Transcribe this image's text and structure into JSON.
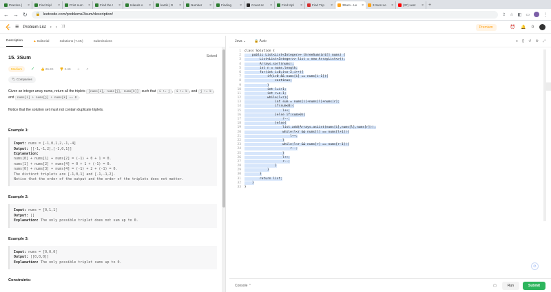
{
  "browser": {
    "tabs": [
      {
        "label": "Practice |",
        "color": "#2e7d32"
      },
      {
        "label": "Find tripl",
        "color": "#2e7d32"
      },
      {
        "label": "Print num",
        "color": "#2e7d32"
      },
      {
        "label": "Find the !",
        "color": "#2e7d32"
      },
      {
        "label": "Islands o",
        "color": "#2e7d32"
      },
      {
        "label": "kartik | G",
        "color": "#2e7d32"
      },
      {
        "label": "Number",
        "color": "#2e7d32"
      },
      {
        "label": "Finding",
        "color": "#2e7d32"
      },
      {
        "label": "Count sc",
        "color": "#222"
      },
      {
        "label": "Find tripl",
        "color": "#2e7d32"
      },
      {
        "label": "Find Trip",
        "color": "#d32f2f"
      },
      {
        "label": "3Sum - Le",
        "color": "#ffa116",
        "active": true
      },
      {
        "label": "3 Sum Le",
        "color": "#ffa116"
      },
      {
        "label": "(37) Leet",
        "color": "#ff0000"
      }
    ],
    "url": "leetcode.com/problems/3sum/description/"
  },
  "header": {
    "problem_list": "Problem List",
    "premium": "Premium",
    "notif_count": "0"
  },
  "left": {
    "tabs": {
      "description": "Description",
      "editorial": "Editorial",
      "solutions": "Solutions (7.4K)",
      "submissions": "Submissions"
    },
    "title": "15. 3Sum",
    "status": "Solved",
    "difficulty": "Medium",
    "likes": "26.3K",
    "dislikes": "2.4K",
    "companies": "Companies",
    "p1a": "Given an integer array nums, return all the triplets",
    "c1": "[nums[i], nums[j], nums[k]]",
    "p1b": "such that",
    "c2": "i != j",
    "c3": "i != k",
    "p1c": ", and",
    "c4": "j != k",
    "p1d": ", and",
    "c5": "nums[i] + nums[j] + nums[k] == 0",
    "p1e": ".",
    "p2": "Notice that the solution set must not contain duplicate triplets.",
    "ex1_h": "Example 1:",
    "ex1": {
      "in_k": "Input:",
      "in": " nums = [-1,0,1,2,-1,-4]",
      "out_k": "Output:",
      "out": " [[-1,-1,2],[-1,0,1]]",
      "exp_k": "Explanation:",
      "exp": "nums[0] + nums[1] + nums[2] = (-1) + 0 + 1 = 0.\nnums[1] + nums[2] + nums[4] = 0 + 1 + (-1) = 0.\nnums[0] + nums[3] + nums[4] = (-1) + 2 + (-1) = 0.\nThe distinct triplets are [-1,0,1] and [-1,-1,2].\nNotice that the order of the output and the order of the triplets does not matter."
    },
    "ex2_h": "Example 2:",
    "ex2": {
      "in_k": "Input:",
      "in": " nums = [0,1,1]",
      "out_k": "Output:",
      "out": " []",
      "exp_k": "Explanation:",
      "exp": " The only possible triplet does not sum up to 0."
    },
    "ex3_h": "Example 3:",
    "ex3": {
      "in_k": "Input:",
      "in": " nums = [0,0,0]",
      "out_k": "Output:",
      "out": " [[0,0,0]]",
      "exp_k": "Explanation:",
      "exp": " The only possible triplet sums up to 0."
    },
    "constraints": "Constraints:"
  },
  "editor": {
    "lang": "Java",
    "mode": "Auto",
    "code": [
      "class Solution {",
      "    public List<List<Integer>> threeSum(int[] nums) {",
      "        List<List<Integer>> list = new ArrayList<>();",
      "        Arrays.sort(nums);",
      "        int n = nums.length;",
      "        for(int i=0;i<n-2;i++){",
      "            if(i>0 && nums[i] == nums[i-1]){",
      "                continue;",
      "            }",
      "            int l=i+1;",
      "            int r=n-1;",
      "            while(l<r){",
      "                int sum = nums[i]+nums[l]+nums[r];",
      "                if(sum<0){",
      "                    l++;",
      "                }else if(sum>0){",
      "                    r--;",
      "                }else{",
      "                    list.add(Arrays.asList(nums[i],nums[l],nums[r]));",
      "                    while(l<r && nums[l] == nums[l+1]){",
      "                        l++;",
      "                    }",
      "                    while(l<r && nums[r] == nums[r-1]){",
      "                        r--;",
      "                    }",
      "                    l++;",
      "                    r--;",
      "                }",
      "            }",
      "        }",
      "        return list;",
      "    }",
      "}"
    ],
    "console": "Console",
    "run": "Run",
    "submit": "Submit"
  }
}
